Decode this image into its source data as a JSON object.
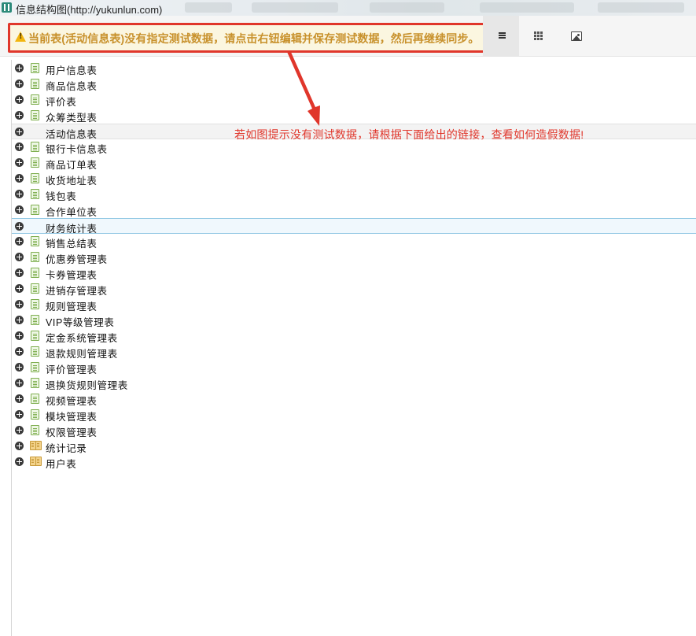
{
  "window": {
    "title": "信息结构图(http://yukunlun.com)"
  },
  "toolbar": {
    "warning": "当前表(活动信息表)没有指定测试数据，请点击右钮编辑并保存测试数据，然后再继续同步。",
    "buttons": [
      {
        "icon": "list-view-icon",
        "active": true
      },
      {
        "icon": "grid-view-icon",
        "active": false
      },
      {
        "icon": "image-view-icon",
        "active": false
      }
    ]
  },
  "annotation": {
    "text": "若如图提示没有测试数据，请根据下面给出的链接，查看如何造假数据!",
    "color": "#e0362b"
  },
  "tree": {
    "items": [
      {
        "label": "用户信息表",
        "icon": "file-icon"
      },
      {
        "label": "商品信息表",
        "icon": "file-icon"
      },
      {
        "label": "评价表",
        "icon": "file-icon"
      },
      {
        "label": "众筹类型表",
        "icon": "file-icon"
      },
      {
        "label": "活动信息表",
        "icon": "none",
        "state": "warning"
      },
      {
        "label": "银行卡信息表",
        "icon": "file-icon"
      },
      {
        "label": "商品订单表",
        "icon": "file-icon"
      },
      {
        "label": "收货地址表",
        "icon": "file-icon"
      },
      {
        "label": "钱包表",
        "icon": "file-icon"
      },
      {
        "label": "合作单位表",
        "icon": "file-icon"
      },
      {
        "label": "财务统计表",
        "icon": "none",
        "state": "selected"
      },
      {
        "label": "销售总结表",
        "icon": "file-icon"
      },
      {
        "label": "优惠券管理表",
        "icon": "file-icon"
      },
      {
        "label": "卡券管理表",
        "icon": "file-icon"
      },
      {
        "label": "进销存管理表",
        "icon": "file-icon"
      },
      {
        "label": "规则管理表",
        "icon": "file-icon"
      },
      {
        "label": "VIP等级管理表",
        "icon": "file-icon"
      },
      {
        "label": "定金系统管理表",
        "icon": "file-icon"
      },
      {
        "label": "退款规则管理表",
        "icon": "file-icon"
      },
      {
        "label": "评价管理表",
        "icon": "file-icon"
      },
      {
        "label": "退换货规则管理表",
        "icon": "file-icon"
      },
      {
        "label": "视频管理表",
        "icon": "file-icon"
      },
      {
        "label": "模块管理表",
        "icon": "file-icon"
      },
      {
        "label": "权限管理表",
        "icon": "file-icon"
      },
      {
        "label": "统计记录",
        "icon": "folder-icon"
      },
      {
        "label": "用户表",
        "icon": "folder-icon"
      }
    ]
  },
  "colors": {
    "warning_text": "#c8912c",
    "warning_border": "#e0362b",
    "selection_border": "#8ec6e3"
  }
}
